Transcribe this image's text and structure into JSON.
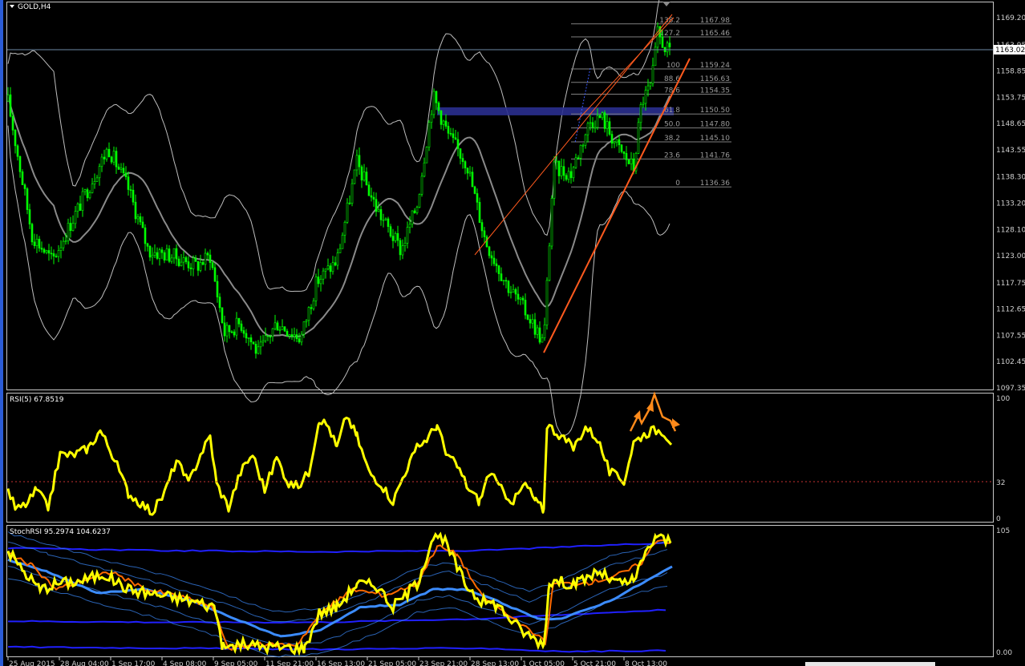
{
  "main": {
    "symbol_label": "GOLD,H4",
    "current_price": "1163.02",
    "price_axis": [
      "1169.20",
      "1163.95",
      "1158.85",
      "1153.75",
      "1148.65",
      "1143.55",
      "1138.30",
      "1133.20",
      "1128.10",
      "1123.00",
      "1117.75",
      "1112.65",
      "1107.55",
      "1102.45",
      "1097.35"
    ],
    "fibonacci": [
      {
        "ratio": "138.2",
        "price": "1167.98"
      },
      {
        "ratio": "127.2",
        "price": "1165.46"
      },
      {
        "ratio": "100",
        "price": "1159.24"
      },
      {
        "ratio": "88.6",
        "price": "1156.63"
      },
      {
        "ratio": "78.6",
        "price": "1154.35"
      },
      {
        "ratio": "61.8",
        "price": "1150.50"
      },
      {
        "ratio": "50.0",
        "price": "1147.80"
      },
      {
        "ratio": "38.2",
        "price": "1145.10"
      },
      {
        "ratio": "23.6",
        "price": "1141.76"
      },
      {
        "ratio": "0",
        "price": "1136.36"
      }
    ]
  },
  "rsi": {
    "label": "RSI(5) 67.8519",
    "axis": {
      "top": "100",
      "mid": "32",
      "bottom": "0"
    }
  },
  "stochrsi": {
    "label": "StochRSI 95.2974 104.6237",
    "axis": {
      "top": "105",
      "bottom": "0.00"
    }
  },
  "time_axis": [
    "25 Aug 2015",
    "28 Aug 04:00",
    "1 Sep 17:00",
    "4 Sep 08:00",
    "9 Sep 05:00",
    "11 Sep 21:00",
    "16 Sep 13:00",
    "21 Sep 05:00",
    "23 Sep 21:00",
    "28 Sep 13:00",
    "1 Oct 05:00",
    "5 Oct 21:00",
    "8 Oct 13:00"
  ],
  "colors": {
    "candles": "#00ff00",
    "rsi": "#ffff00",
    "bollinger": "#bebebe",
    "mid_band": "#8a8a8a",
    "trendline": "#ff5a1e",
    "zone": "#2a2f8f",
    "fib": "#7f7f7f",
    "stoch_blue": "#2020ff",
    "stoch_light": "#3c8cff",
    "stoch_orange": "#ff6a00",
    "arrows": "#ff8a1a"
  }
}
